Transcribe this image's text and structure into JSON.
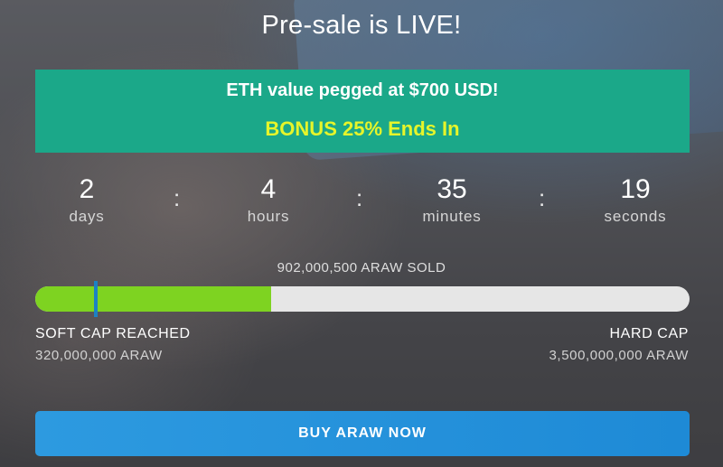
{
  "title": "Pre-sale is LIVE!",
  "promo": {
    "line1": "ETH value pegged at $700 USD!",
    "line2": "BONUS 25% Ends In"
  },
  "countdown": {
    "separator": ":",
    "units": [
      {
        "value": "2",
        "label": "days"
      },
      {
        "value": "4",
        "label": "hours"
      },
      {
        "value": "35",
        "label": "minutes"
      },
      {
        "value": "19",
        "label": "seconds"
      }
    ]
  },
  "progress": {
    "sold_text": "902,000,500 ARAW SOLD",
    "fill_fraction": 0.36,
    "soft_cap_fraction": 0.093
  },
  "soft_cap": {
    "title": "SOFT CAP REACHED",
    "amount": "320,000,000 ARAW"
  },
  "hard_cap": {
    "title": "HARD CAP",
    "amount": "3,500,000,000 ARAW"
  },
  "buy_button": {
    "label": "BUY ARAW NOW"
  },
  "colors": {
    "promo_bg": "#1ba889",
    "bonus_text": "#e6f52a",
    "progress_fill": "#7ed321",
    "soft_cap_marker": "#1b82c4",
    "button": "#2d9ae0"
  }
}
